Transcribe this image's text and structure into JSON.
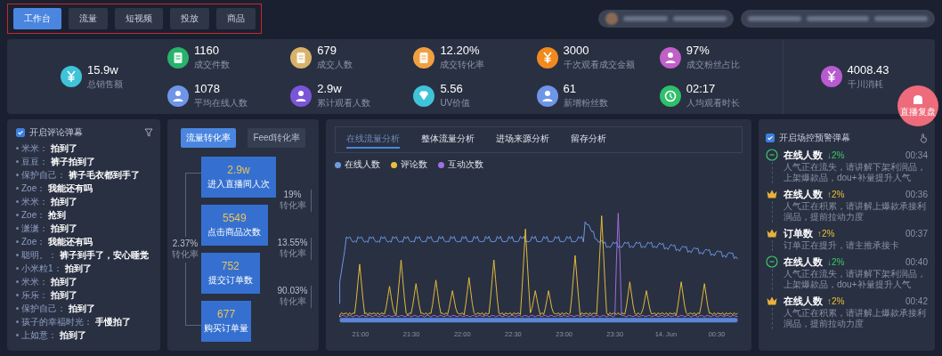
{
  "tabs": [
    {
      "label": "工作台",
      "selected": true
    },
    {
      "label": "流量",
      "selected": false
    },
    {
      "label": "短视频",
      "selected": false
    },
    {
      "label": "投放",
      "selected": false
    },
    {
      "label": "商品",
      "selected": false
    }
  ],
  "stats": {
    "main": {
      "value": "15.9w",
      "label": "总销售额",
      "kind": "money",
      "color": "#3fc3d8"
    },
    "grid": [
      {
        "value": "1160",
        "label": "成交件数",
        "kind": "order",
        "color": "#27b36a"
      },
      {
        "value": "679",
        "label": "成交人数",
        "kind": "order",
        "color": "#d9b26a"
      },
      {
        "value": "12.20%",
        "label": "成交转化率",
        "kind": "order",
        "color": "#f0a040"
      },
      {
        "value": "3000",
        "label": "千次观看成交金额",
        "kind": "money",
        "color": "#f08a1e"
      },
      {
        "value": "97%",
        "label": "成交粉丝占比",
        "kind": "user",
        "color": "#c060c8"
      },
      {
        "value": "1078",
        "label": "平均在线人数",
        "kind": "user",
        "color": "#6f95e8"
      },
      {
        "value": "2.9w",
        "label": "累计观看人数",
        "kind": "user",
        "color": "#7a55d8"
      },
      {
        "value": "5.56",
        "label": "UV价值",
        "kind": "value",
        "color": "#3fc3d8"
      },
      {
        "value": "61",
        "label": "新增粉丝数",
        "kind": "user",
        "color": "#6f95e8"
      },
      {
        "value": "02:17",
        "label": "人均观看时长",
        "kind": "time",
        "color": "#2fbf6a"
      }
    ],
    "side": {
      "value": "4008.43",
      "label": "千川消耗",
      "kind": "money",
      "color": "#b85ad0"
    }
  },
  "float_button": {
    "label": "直播复盘"
  },
  "comments": {
    "header": "开启评论弹幕",
    "checked": true,
    "items": [
      {
        "user": "米米：",
        "text": "拍到了"
      },
      {
        "user": "豆豆：",
        "text": "裤子拍到了"
      },
      {
        "user": "保护自己：",
        "text": "裤子毛衣都到手了"
      },
      {
        "user": "Zoe：",
        "text": "我能还有吗"
      },
      {
        "user": "米米：",
        "text": "拍到了"
      },
      {
        "user": "Zoe：",
        "text": "抢到"
      },
      {
        "user": "潇潇：",
        "text": "拍到了"
      },
      {
        "user": "Zoe：",
        "text": "我能还有吗"
      },
      {
        "user": "聪明。：",
        "text": "裤子到手了，安心睡觉"
      },
      {
        "user": "小米粒1：",
        "text": "拍到了"
      },
      {
        "user": "米米：",
        "text": "拍到了"
      },
      {
        "user": "乐乐：",
        "text": "拍到了"
      },
      {
        "user": "保护自己：",
        "text": "拍到了"
      },
      {
        "user": "孩子的幸福时光：",
        "text": "手慢拍了"
      },
      {
        "user": "上如意：",
        "text": "拍到了"
      }
    ]
  },
  "funnel": {
    "tabs": [
      {
        "label": "流量转化率",
        "selected": true
      },
      {
        "label": "Feed转化率",
        "selected": false
      }
    ],
    "steps": [
      {
        "value": "2.9w",
        "label": "进入直播间人次"
      },
      {
        "value": "5549",
        "label": "点击商品次数"
      },
      {
        "value": "752",
        "label": "提交订单数"
      },
      {
        "value": "677",
        "label": "购买订单量"
      }
    ],
    "rates": [
      {
        "value": "19%",
        "label": "转化率"
      },
      {
        "value": "13.55%",
        "label": "转化率"
      },
      {
        "value": "90.03%",
        "label": "转化率"
      }
    ],
    "total_rate": {
      "value": "2.37%",
      "label": "转化率"
    }
  },
  "traffic": {
    "tabs": [
      {
        "label": "在线流量分析",
        "selected": true
      },
      {
        "label": "整体流量分析",
        "selected": false
      },
      {
        "label": "进场来源分析",
        "selected": false
      },
      {
        "label": "留存分析",
        "selected": false
      }
    ],
    "legend": [
      {
        "label": "在线人数",
        "color": "#6f9ae8"
      },
      {
        "label": "评论数",
        "color": "#e8c03a"
      },
      {
        "label": "互动次数",
        "color": "#a070e0"
      }
    ],
    "range_slider": {
      "level": 1
    },
    "x_labels": [
      "21:00",
      "21:30",
      "22:00",
      "22:30",
      "23:00",
      "23:30",
      "14. Jun",
      "00:30"
    ]
  },
  "alerts": {
    "header": "开启场控预警弹幕",
    "checked": true,
    "items": [
      {
        "kind": "down",
        "title": "在线人数",
        "change": "↓2%",
        "time": "00:34",
        "text": "人气正在流失，请讲解下架利润品，上架爆款品，dou+补量提升人气"
      },
      {
        "kind": "up",
        "title": "在线人数",
        "change": "↑2%",
        "time": "00:36",
        "text": "人气正在积累，请讲解上爆款承接利润品，提前拉动力度"
      },
      {
        "kind": "up",
        "title": "订单数",
        "change": "↑2%",
        "time": "00:37",
        "text": "订单正在提升，请主推承接卡"
      },
      {
        "kind": "down",
        "title": "在线人数",
        "change": "↓2%",
        "time": "00:40",
        "text": "人气正在流失，请讲解下架利润品，上架爆款品，dou+补量提升人气"
      },
      {
        "kind": "up",
        "title": "在线人数",
        "change": "↑2%",
        "time": "00:42",
        "text": "人气正在积累，请讲解上爆款承接利润品，提前拉动力度"
      }
    ]
  }
}
